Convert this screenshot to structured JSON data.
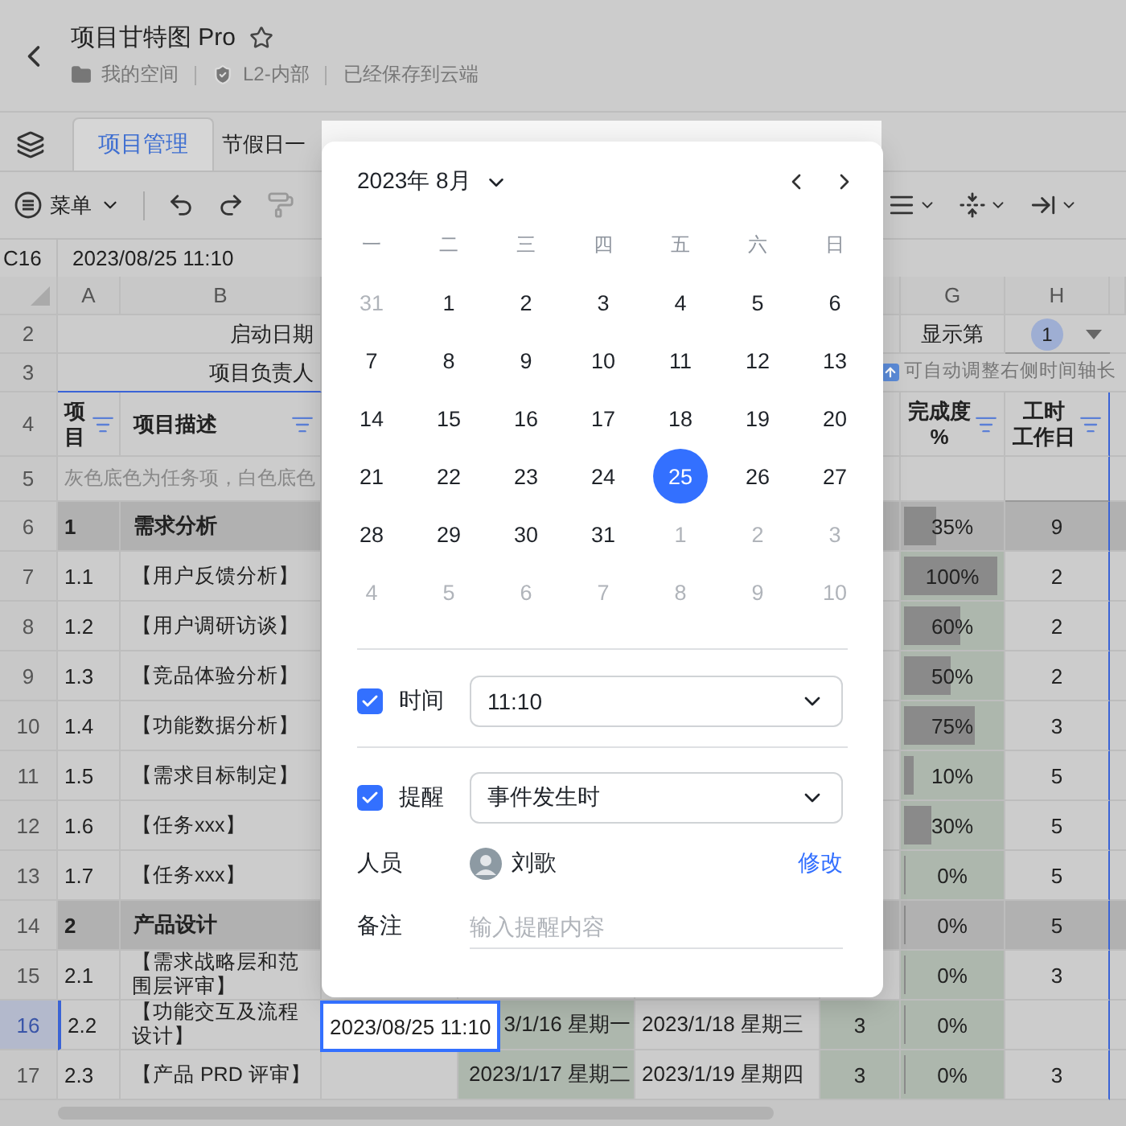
{
  "header": {
    "title": "项目甘特图 Pro",
    "breadcrumbs": [
      {
        "label": "我的空间",
        "kind": "folder"
      },
      {
        "label": "L2-内部",
        "kind": "shield"
      },
      {
        "label": "已经保存到云端",
        "kind": "text"
      }
    ]
  },
  "tabs": [
    {
      "label": "项目管理",
      "selected": true
    },
    {
      "label": "节假日一",
      "selected": false
    }
  ],
  "toolbar": {
    "menu": "菜单"
  },
  "formula_bar": {
    "cell": "C16",
    "value": "2023/08/25 11:10"
  },
  "sheet": {
    "columns": [
      "A",
      "B",
      "G",
      "H"
    ],
    "rows": [
      {
        "num": "2",
        "kind": "meta",
        "selected": false,
        "name": "启动日期",
        "display_label": "显示第",
        "display_value": "1"
      },
      {
        "num": "3",
        "kind": "meta",
        "selected": false,
        "name": "项目负责人",
        "hint": "可自动调整右侧时间轴长"
      },
      {
        "num": "4",
        "kind": "header",
        "selected": false,
        "id": "项目",
        "name": "项目描述",
        "progress": [
          "完成度",
          "%"
        ],
        "hours": [
          "工时",
          "工作日"
        ]
      },
      {
        "num": "5",
        "kind": "note",
        "selected": false,
        "id": "灰色底色为任务项，白色底色"
      },
      {
        "num": "6",
        "kind": "group",
        "selected": false,
        "id": "1",
        "name": "需求分析",
        "progress": {
          "text": "35%",
          "level": 0.35
        },
        "hours": "9"
      },
      {
        "num": "7",
        "kind": "task",
        "selected": false,
        "id": "1.1",
        "name": "【用户反馈分析】",
        "progress": {
          "text": "100%",
          "level": 1
        },
        "hours": "2"
      },
      {
        "num": "8",
        "kind": "task",
        "selected": false,
        "id": "1.2",
        "name": "【用户调研访谈】",
        "progress": {
          "text": "60%",
          "level": 0.6
        },
        "hours": "2"
      },
      {
        "num": "9",
        "kind": "task",
        "selected": false,
        "id": "1.3",
        "name": "【竞品体验分析】",
        "progress": {
          "text": "50%",
          "level": 0.5
        },
        "hours": "2"
      },
      {
        "num": "10",
        "kind": "task",
        "selected": false,
        "id": "1.4",
        "name": "【功能数据分析】",
        "progress": {
          "text": "75%",
          "level": 0.75
        },
        "hours": "3"
      },
      {
        "num": "11",
        "kind": "task",
        "selected": false,
        "id": "1.5",
        "name": "【需求目标制定】",
        "progress": {
          "text": "10%",
          "level": 0.1
        },
        "hours": "5"
      },
      {
        "num": "12",
        "kind": "task",
        "selected": false,
        "id": "1.6",
        "name": "【任务xxx】",
        "progress": {
          "text": "30%",
          "level": 0.3
        },
        "hours": "5"
      },
      {
        "num": "13",
        "kind": "task",
        "selected": false,
        "id": "1.7",
        "name": "【任务xxx】",
        "progress": {
          "text": "0%",
          "level": 0
        },
        "hours": "5"
      },
      {
        "num": "14",
        "kind": "group",
        "selected": false,
        "id": "2",
        "name": "产品设计",
        "progress": {
          "text": "0%",
          "level": 0
        },
        "hours": "5"
      },
      {
        "num": "15",
        "kind": "task",
        "selected": false,
        "id": "2.1",
        "name": "【需求战略层和范围层评审】",
        "progress": {
          "text": "0%",
          "level": 0
        },
        "hours": "3"
      },
      {
        "num": "16",
        "kind": "task",
        "selected": true,
        "id": "2.2",
        "name": "【功能交互及流程设计】",
        "editor": "2023/08/25 11:10",
        "start": "3/1/16 星期一",
        "end": "2023/1/18 星期三",
        "days": "3",
        "progress": {
          "text": "0%",
          "level": 0
        }
      },
      {
        "num": "17",
        "kind": "task",
        "selected": false,
        "id": "2.3",
        "name": "【产品 PRD 评审】",
        "start": "2023/1/17 星期二",
        "end": "2023/1/19 星期四",
        "days": "3",
        "progress": {
          "text": "0%",
          "level": 0
        },
        "hours": "3"
      }
    ]
  },
  "date_picker": {
    "month_label": "2023年 8月",
    "weekdays": [
      "一",
      "二",
      "三",
      "四",
      "五",
      "六",
      "日"
    ],
    "days": [
      {
        "label": "31",
        "muted": true,
        "selected": false
      },
      {
        "label": "1",
        "muted": false,
        "selected": false
      },
      {
        "label": "2",
        "muted": false,
        "selected": false
      },
      {
        "label": "3",
        "muted": false,
        "selected": false
      },
      {
        "label": "4",
        "muted": false,
        "selected": false
      },
      {
        "label": "5",
        "muted": false,
        "selected": false
      },
      {
        "label": "6",
        "muted": false,
        "selected": false
      },
      {
        "label": "7",
        "muted": false,
        "selected": false
      },
      {
        "label": "8",
        "muted": false,
        "selected": false
      },
      {
        "label": "9",
        "muted": false,
        "selected": false
      },
      {
        "label": "10",
        "muted": false,
        "selected": false
      },
      {
        "label": "11",
        "muted": false,
        "selected": false
      },
      {
        "label": "12",
        "muted": false,
        "selected": false
      },
      {
        "label": "13",
        "muted": false,
        "selected": false
      },
      {
        "label": "14",
        "muted": false,
        "selected": false
      },
      {
        "label": "15",
        "muted": false,
        "selected": false
      },
      {
        "label": "16",
        "muted": false,
        "selected": false
      },
      {
        "label": "17",
        "muted": false,
        "selected": false
      },
      {
        "label": "18",
        "muted": false,
        "selected": false
      },
      {
        "label": "19",
        "muted": false,
        "selected": false
      },
      {
        "label": "20",
        "muted": false,
        "selected": false
      },
      {
        "label": "21",
        "muted": false,
        "selected": false
      },
      {
        "label": "22",
        "muted": false,
        "selected": false
      },
      {
        "label": "23",
        "muted": false,
        "selected": false
      },
      {
        "label": "24",
        "muted": false,
        "selected": false
      },
      {
        "label": "25",
        "muted": false,
        "selected": true
      },
      {
        "label": "26",
        "muted": false,
        "selected": false
      },
      {
        "label": "27",
        "muted": false,
        "selected": false
      },
      {
        "label": "28",
        "muted": false,
        "selected": false
      },
      {
        "label": "29",
        "muted": false,
        "selected": false
      },
      {
        "label": "30",
        "muted": false,
        "selected": false
      },
      {
        "label": "31",
        "muted": false,
        "selected": false
      },
      {
        "label": "1",
        "muted": true,
        "selected": false
      },
      {
        "label": "2",
        "muted": true,
        "selected": false
      },
      {
        "label": "3",
        "muted": true,
        "selected": false
      },
      {
        "label": "4",
        "muted": true,
        "selected": false
      },
      {
        "label": "5",
        "muted": true,
        "selected": false
      },
      {
        "label": "6",
        "muted": true,
        "selected": false
      },
      {
        "label": "7",
        "muted": true,
        "selected": false
      },
      {
        "label": "8",
        "muted": true,
        "selected": false
      },
      {
        "label": "9",
        "muted": true,
        "selected": false
      },
      {
        "label": "10",
        "muted": true,
        "selected": false
      }
    ],
    "time": {
      "label": "时间",
      "checked": true,
      "value": "11:10"
    },
    "reminder": {
      "label": "提醒",
      "checked": true,
      "value": "事件发生时"
    },
    "person": {
      "label": "人员",
      "name": "刘歌",
      "action": "修改"
    },
    "note": {
      "label": "备注",
      "placeholder": "输入提醒内容"
    }
  }
}
